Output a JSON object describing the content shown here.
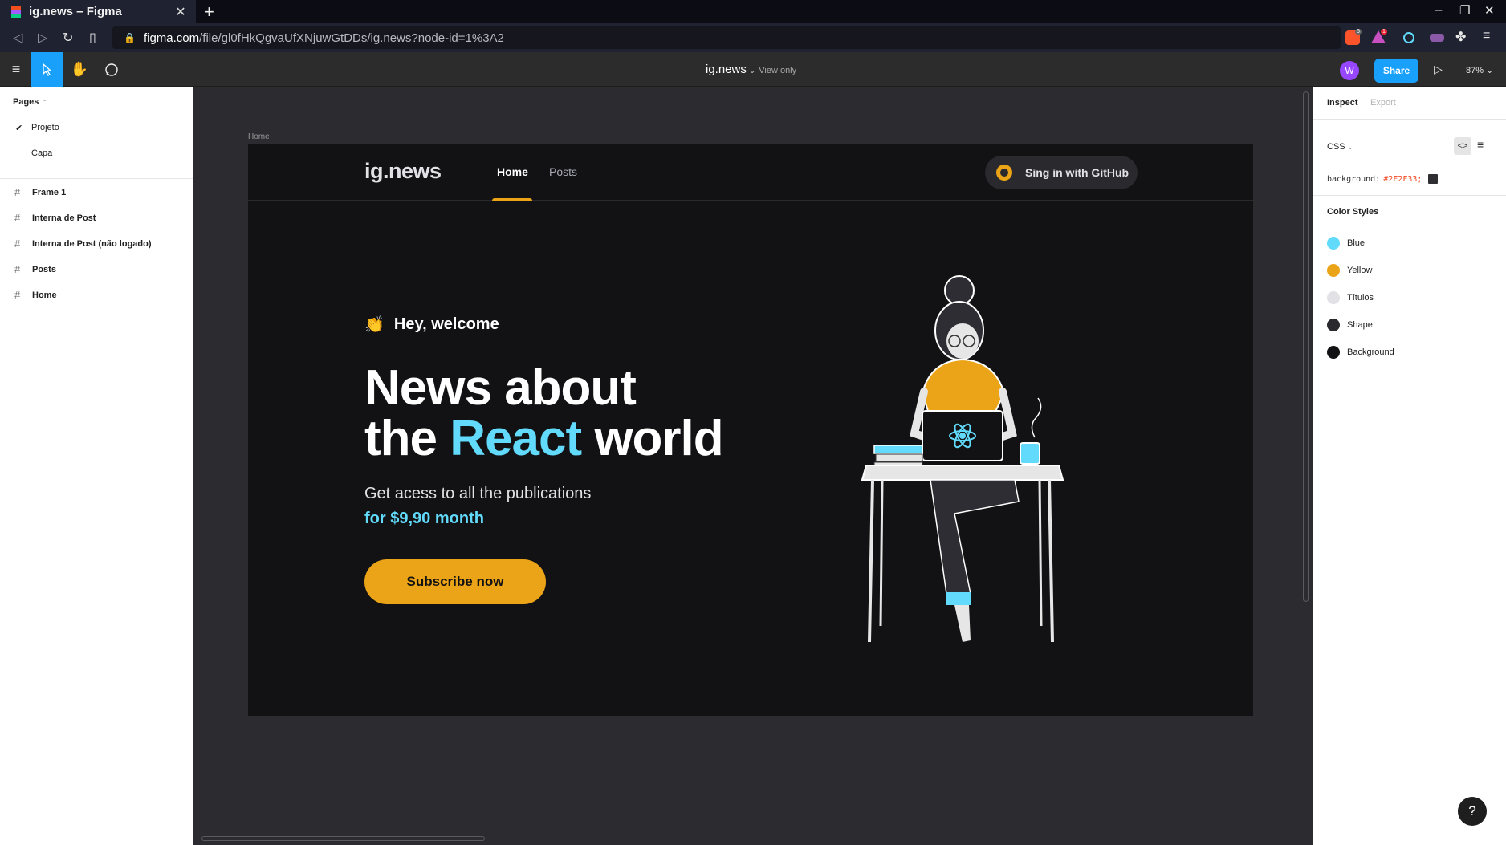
{
  "browser": {
    "tab_title": "ig.news – Figma",
    "tab_close": "✕",
    "new_tab": "+",
    "url_host": "figma.com",
    "url_path": "/file/gl0fHkQgvaUfXNjuwGtDDs/ig.news?node-id=1%3A2",
    "window_controls": [
      "–",
      "❐",
      "✕"
    ],
    "badges": [
      "5",
      "1"
    ]
  },
  "figma_toolbar": {
    "file_name": "ig.news",
    "view_mode": "View only",
    "avatar_initial": "W",
    "share_label": "Share",
    "zoom": "87%"
  },
  "pages_panel": {
    "heading": "Pages",
    "pages": [
      {
        "label": "Projeto",
        "selected": true
      },
      {
        "label": "Capa",
        "selected": false
      }
    ],
    "frames": [
      "Frame 1",
      "Interna de Post",
      "Interna de Post (não logado)",
      "Posts",
      "Home"
    ]
  },
  "canvas": {
    "frame_label": "Home",
    "site": {
      "logo": "ig.news",
      "nav": [
        "Home",
        "Posts"
      ],
      "github_button": "Sing in with GitHub",
      "greeting": "Hey, welcome",
      "headline_line1": "News about",
      "headline_the": "the ",
      "headline_react": "React",
      "headline_world": " world",
      "subtitle": "Get acess to all the publications",
      "price": "for $9,90 month",
      "cta": "Subscribe now"
    }
  },
  "inspect_panel": {
    "tabs": [
      "Inspect",
      "Export"
    ],
    "language": "CSS",
    "code_property": "background:",
    "code_value": "#2F2F33;",
    "color_styles_title": "Color Styles",
    "color_styles": [
      {
        "name": "Blue",
        "color": "#61dafb"
      },
      {
        "name": "Yellow",
        "color": "#eba417"
      },
      {
        "name": "Títulos",
        "color": "#e1e1e6"
      },
      {
        "name": "Shape",
        "color": "#29292e"
      },
      {
        "name": "Background",
        "color": "#121214"
      }
    ]
  },
  "colors": {
    "figma_blue": "#18a0fb",
    "accent_yellow": "#eba417",
    "accent_blue": "#61dafb",
    "frame_bg": "#121214"
  }
}
